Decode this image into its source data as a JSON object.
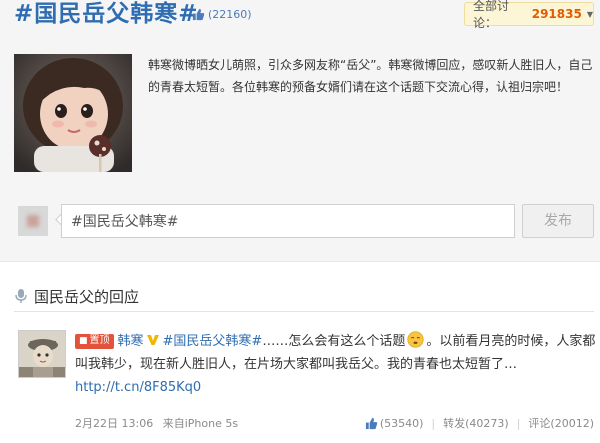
{
  "topic": {
    "title": "#国民岳父韩寒#",
    "like_count": "(22160)",
    "discussion_label": "全部讨论：",
    "discussion_count": "291835",
    "description": "韩寒微博晒女儿萌照，引众多网友称“岳父”。韩寒微博回应，感叹新人胜旧人，自己的青春太短暂。各位韩寒的预备女婿们请在这个话题下交流心得，认祖归宗吧！"
  },
  "composer": {
    "placeholder": "#国民岳父韩寒#",
    "publish_label": "发布"
  },
  "section": {
    "title": "国民岳父的回应"
  },
  "post": {
    "pin_label": "置顶",
    "author": "韩寒",
    "topic_tag": "#国民岳父韩寒#",
    "text_before_emoji": "……怎么会有这么个话题",
    "text_after_emoji": "。以前看月亮的时候，人家都叫我韩少，现在新人胜旧人，在片场大家都叫我岳父。我的青春也太短暂了…",
    "link": "http://t.cn/8F85Kq0",
    "date": "2月22日 13:06",
    "source": "来自iPhone 5s",
    "like_count": "(53540)",
    "repost_label": "转发(40273)",
    "comment_label": "评论(20012)"
  },
  "colors": {
    "link_blue": "#2e6db1",
    "count_orange": "#e15c00",
    "pin_red": "#e3523b",
    "vip_gold": "#f2b600"
  },
  "icons": {
    "like": "thumbs-up-icon",
    "section": "microphone-icon",
    "verified": "verified-v-icon",
    "emoji": "sleepy-face-emoji-icon",
    "pin": "pin-icon"
  }
}
